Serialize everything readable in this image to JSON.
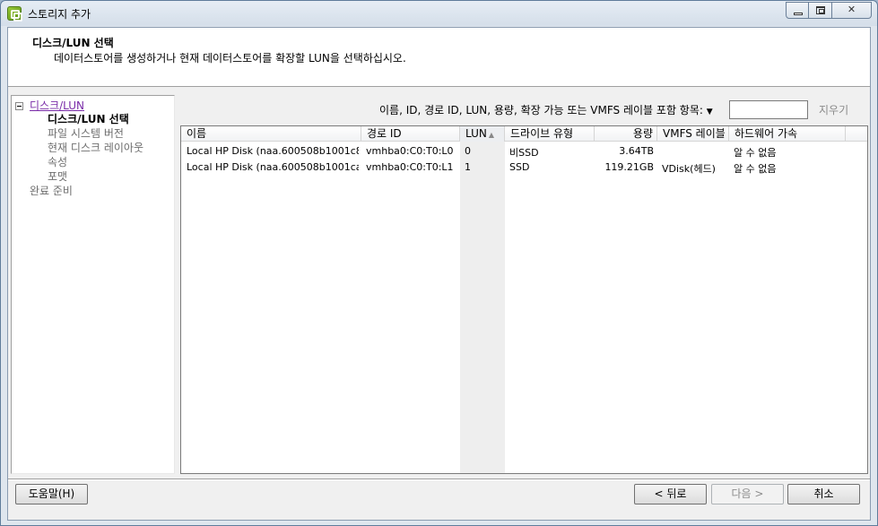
{
  "window": {
    "title": "스토리지 추가",
    "icon": "vsphere-app-icon",
    "controls": [
      "minimize",
      "maximize",
      "close"
    ]
  },
  "header": {
    "title": "디스크/LUN 선택",
    "description": "데이터스토어를 생성하거나 현재 데이터스토어를 확장할 LUN을 선택하십시오."
  },
  "nav": {
    "group_label": "디스크/LUN",
    "items": [
      {
        "label": "디스크/LUN 선택",
        "state": "current"
      },
      {
        "label": "파일 시스템 버전",
        "state": "pending"
      },
      {
        "label": "현재 디스크 레이아웃",
        "state": "pending"
      },
      {
        "label": "속성",
        "state": "pending"
      },
      {
        "label": "포맷",
        "state": "pending"
      }
    ],
    "final_item": "완료 준비"
  },
  "filter": {
    "label": "이름, ID, 경로 ID, LUN, 용량, 확장 가능 또는 VMFS 레이블 포함 항목:",
    "value": "",
    "clear_label": "지우기"
  },
  "table": {
    "columns": [
      "이름",
      "경로 ID",
      "LUN",
      "드라이브 유형",
      "용량",
      "VMFS 레이블",
      "하드웨어 가속"
    ],
    "sorted_column": "LUN",
    "rows": [
      {
        "name": "Local HP Disk (naa.600508b1001c8c...",
        "path_id": "vmhba0:C0:T0:L0",
        "lun": "0",
        "drive_type": "비SSD",
        "capacity": "3.64TB",
        "vmfs_label": "",
        "hw_accel": "알 수 없음"
      },
      {
        "name": "Local HP Disk (naa.600508b1001ca...",
        "path_id": "vmhba0:C0:T0:L1",
        "lun": "1",
        "drive_type": "SSD",
        "capacity": "119.21GB",
        "vmfs_label": "VDisk(헤드)",
        "hw_accel": "알 수 없음"
      }
    ]
  },
  "buttons": {
    "help": "도움말(H)",
    "back": "< 뒤로",
    "next": "다음 >",
    "cancel": "취소"
  }
}
